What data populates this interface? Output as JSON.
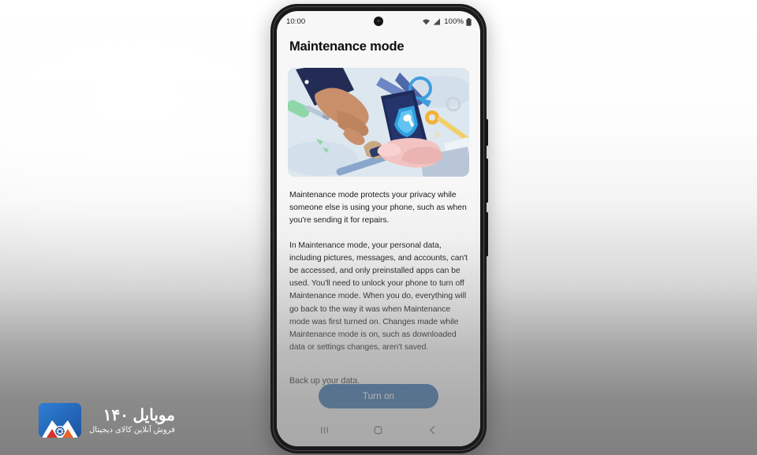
{
  "background": {
    "top_color": "#ffffff",
    "bottom_color": "#808080"
  },
  "phone": {
    "status_bar": {
      "time": "10:00",
      "battery_percent": "100%",
      "icons": [
        "wifi-icon",
        "cellular-signal-icon",
        "battery-icon"
      ],
      "camera": "front-camera-punch-hole"
    },
    "page_title": "Maintenance mode",
    "illustration": {
      "name": "maintenance-mode-illustration",
      "description": "Two hands exchanging a smartphone displaying a shield with a wrench, surrounded by repair tools",
      "background_color": "#dfe8ef",
      "phone_color": "#1e2b5a",
      "shield_color": "#2f9fe0",
      "elements": [
        "screwdriver",
        "hammer",
        "pliers",
        "pencil",
        "gear",
        "shield-wrench-icon",
        "hand-dark-sleeve",
        "hand-pink-sleeve"
      ]
    },
    "paragraphs": [
      "Maintenance mode protects your privacy while someone else is using your phone, such as when you're sending it for repairs.",
      "In Maintenance mode, your personal data, including pictures, messages, and accounts, can't be accessed, and only preinstalled apps can be used. You'll need to unlock your phone to turn off Maintenance mode. When you do, everything will go back to the way it was when Maintenance mode was first turned on. Changes made while Maintenance mode is on, such as downloaded data or settings changes, aren't saved.",
      "Back up your data."
    ],
    "primary_button": {
      "label": "Turn on",
      "color": "#1b5fa5",
      "text_color": "#ffffff"
    },
    "navigation_bar": {
      "recents_label": "recents-icon",
      "home_label": "home-icon",
      "back_label": "back-icon"
    }
  },
  "watermark": {
    "brand_title": "موبایل ۱۴۰",
    "brand_subtitle": "فروش آنلاین کالای دیجیتال",
    "logo_name": "mobile140-logo",
    "logo_color": "#1f63b4",
    "accent_red": "#d8322c",
    "accent_orange": "#e8622a"
  }
}
